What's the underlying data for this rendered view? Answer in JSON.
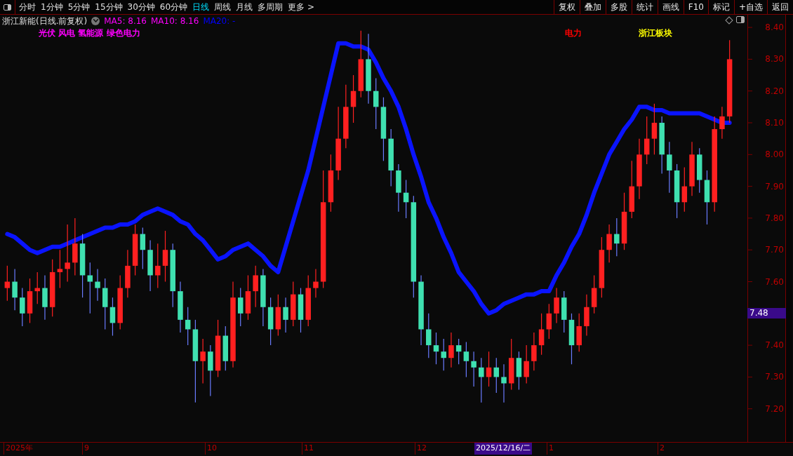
{
  "toolbar": {
    "periods": [
      {
        "label": "分时",
        "selected": false
      },
      {
        "label": "1分钟",
        "selected": false
      },
      {
        "label": "5分钟",
        "selected": false
      },
      {
        "label": "15分钟",
        "selected": false
      },
      {
        "label": "30分钟",
        "selected": false
      },
      {
        "label": "60分钟",
        "selected": false
      },
      {
        "label": "日线",
        "selected": true
      },
      {
        "label": "周线",
        "selected": false
      },
      {
        "label": "月线",
        "selected": false
      },
      {
        "label": "多周期",
        "selected": false
      }
    ],
    "more": "更多 >",
    "actions": [
      "复权",
      "叠加",
      "多股",
      "统计",
      "画线",
      "F10",
      "标记",
      "+自选",
      "返回"
    ]
  },
  "header": {
    "title": "浙江新能(日线.前复权)",
    "indicators": [
      {
        "label": "MA5: 8.16",
        "color": "#ff00ff"
      },
      {
        "label": "MA10: 8.16",
        "color": "#ff00ff"
      },
      {
        "label": "MA20: -",
        "color": "#0000ff"
      }
    ]
  },
  "tags": [
    {
      "text": "光伏 风电 氢能源 绿色电力",
      "color": "#ff00ff"
    },
    {
      "text": "电力",
      "color": "#ff0000"
    },
    {
      "text": "浙江板块",
      "color": "#ffff00"
    }
  ],
  "chart_data": {
    "type": "candlestick",
    "ylim": [
      7.1,
      8.44
    ],
    "series": [
      {
        "type": "line",
        "color": "#0a14ff",
        "values": [
          7.75,
          7.74,
          7.72,
          7.7,
          7.69,
          7.7,
          7.71,
          7.71,
          7.72,
          7.73,
          7.74,
          7.75,
          7.76,
          7.77,
          7.77,
          7.78,
          7.78,
          7.79,
          7.81,
          7.82,
          7.83,
          7.82,
          7.81,
          7.79,
          7.78,
          7.75,
          7.73,
          7.7,
          7.67,
          7.68,
          7.7,
          7.71,
          7.72,
          7.7,
          7.68,
          7.65,
          7.63,
          7.71,
          7.79,
          7.87,
          7.95,
          8.05,
          8.15,
          8.25,
          8.35,
          8.35,
          8.34,
          8.34,
          8.33,
          8.29,
          8.24,
          8.2,
          8.15,
          8.08,
          8.0,
          7.93,
          7.85,
          7.8,
          7.74,
          7.69,
          7.63,
          7.6,
          7.57,
          7.53,
          7.5,
          7.51,
          7.53,
          7.54,
          7.55,
          7.56,
          7.56,
          7.57,
          7.57,
          7.62,
          7.66,
          7.71,
          7.75,
          7.81,
          7.88,
          7.94,
          8.0,
          8.04,
          8.08,
          8.11,
          8.15,
          8.15,
          8.14,
          8.14,
          8.13,
          8.13,
          8.13,
          8.13,
          8.13,
          8.12,
          8.11,
          8.1,
          8.1
        ]
      }
    ],
    "ohlc": [
      [
        7.58,
        7.65,
        7.54,
        7.6
      ],
      [
        7.6,
        7.64,
        7.51,
        7.55
      ],
      [
        7.55,
        7.58,
        7.46,
        7.5
      ],
      [
        7.5,
        7.61,
        7.47,
        7.57
      ],
      [
        7.57,
        7.63,
        7.53,
        7.58
      ],
      [
        7.58,
        7.62,
        7.48,
        7.52
      ],
      [
        7.52,
        7.67,
        7.49,
        7.63
      ],
      [
        7.63,
        7.7,
        7.58,
        7.64
      ],
      [
        7.64,
        7.78,
        7.6,
        7.66
      ],
      [
        7.66,
        7.8,
        7.62,
        7.72
      ],
      [
        7.72,
        7.75,
        7.55,
        7.62
      ],
      [
        7.62,
        7.66,
        7.5,
        7.6
      ],
      [
        7.6,
        7.64,
        7.54,
        7.58
      ],
      [
        7.58,
        7.61,
        7.45,
        7.52
      ],
      [
        7.52,
        7.55,
        7.43,
        7.47
      ],
      [
        7.47,
        7.62,
        7.45,
        7.58
      ],
      [
        7.58,
        7.7,
        7.55,
        7.65
      ],
      [
        7.65,
        7.78,
        7.62,
        7.75
      ],
      [
        7.75,
        7.77,
        7.64,
        7.7
      ],
      [
        7.7,
        7.73,
        7.57,
        7.62
      ],
      [
        7.62,
        7.72,
        7.58,
        7.65
      ],
      [
        7.65,
        7.76,
        7.6,
        7.7
      ],
      [
        7.7,
        7.72,
        7.52,
        7.57
      ],
      [
        7.57,
        7.6,
        7.44,
        7.48
      ],
      [
        7.48,
        7.52,
        7.4,
        7.45
      ],
      [
        7.45,
        7.48,
        7.22,
        7.35
      ],
      [
        7.35,
        7.42,
        7.28,
        7.38
      ],
      [
        7.38,
        7.4,
        7.24,
        7.32
      ],
      [
        7.32,
        7.48,
        7.3,
        7.43
      ],
      [
        7.43,
        7.46,
        7.32,
        7.35
      ],
      [
        7.35,
        7.6,
        7.33,
        7.55
      ],
      [
        7.55,
        7.58,
        7.46,
        7.5
      ],
      [
        7.5,
        7.62,
        7.48,
        7.57
      ],
      [
        7.57,
        7.65,
        7.52,
        7.62
      ],
      [
        7.62,
        7.64,
        7.46,
        7.52
      ],
      [
        7.52,
        7.55,
        7.4,
        7.45
      ],
      [
        7.45,
        7.56,
        7.43,
        7.52
      ],
      [
        7.52,
        7.55,
        7.44,
        7.48
      ],
      [
        7.48,
        7.6,
        7.46,
        7.56
      ],
      [
        7.56,
        7.58,
        7.44,
        7.48
      ],
      [
        7.48,
        7.62,
        7.46,
        7.58
      ],
      [
        7.58,
        7.64,
        7.55,
        7.6
      ],
      [
        7.6,
        7.95,
        7.58,
        7.85
      ],
      [
        7.85,
        8.0,
        7.82,
        7.95
      ],
      [
        7.95,
        8.15,
        7.92,
        8.05
      ],
      [
        8.05,
        8.22,
        8.02,
        8.15
      ],
      [
        8.15,
        8.25,
        8.1,
        8.2
      ],
      [
        8.2,
        8.39,
        8.18,
        8.3
      ],
      [
        8.3,
        8.38,
        8.16,
        8.2
      ],
      [
        8.2,
        8.24,
        8.08,
        8.15
      ],
      [
        8.15,
        8.18,
        7.98,
        8.05
      ],
      [
        8.05,
        8.08,
        7.9,
        7.95
      ],
      [
        7.95,
        7.97,
        7.82,
        7.88
      ],
      [
        7.88,
        7.92,
        7.8,
        7.85
      ],
      [
        7.85,
        7.87,
        7.55,
        7.6
      ],
      [
        7.6,
        7.62,
        7.4,
        7.45
      ],
      [
        7.45,
        7.5,
        7.36,
        7.4
      ],
      [
        7.4,
        7.44,
        7.34,
        7.38
      ],
      [
        7.38,
        7.42,
        7.32,
        7.36
      ],
      [
        7.36,
        7.44,
        7.33,
        7.4
      ],
      [
        7.4,
        7.42,
        7.34,
        7.38
      ],
      [
        7.38,
        7.41,
        7.3,
        7.35
      ],
      [
        7.35,
        7.38,
        7.27,
        7.33
      ],
      [
        7.33,
        7.36,
        7.22,
        7.3
      ],
      [
        7.3,
        7.38,
        7.27,
        7.33
      ],
      [
        7.33,
        7.36,
        7.25,
        7.3
      ],
      [
        7.3,
        7.34,
        7.22,
        7.28
      ],
      [
        7.28,
        7.42,
        7.26,
        7.36
      ],
      [
        7.36,
        7.38,
        7.26,
        7.3
      ],
      [
        7.3,
        7.4,
        7.28,
        7.35
      ],
      [
        7.35,
        7.44,
        7.32,
        7.4
      ],
      [
        7.4,
        7.5,
        7.37,
        7.45
      ],
      [
        7.45,
        7.53,
        7.42,
        7.5
      ],
      [
        7.5,
        7.58,
        7.47,
        7.55
      ],
      [
        7.55,
        7.57,
        7.44,
        7.48
      ],
      [
        7.48,
        7.5,
        7.34,
        7.4
      ],
      [
        7.4,
        7.5,
        7.38,
        7.46
      ],
      [
        7.46,
        7.56,
        7.43,
        7.52
      ],
      [
        7.52,
        7.62,
        7.5,
        7.58
      ],
      [
        7.58,
        7.74,
        7.55,
        7.7
      ],
      [
        7.7,
        7.78,
        7.66,
        7.75
      ],
      [
        7.75,
        7.8,
        7.68,
        7.72
      ],
      [
        7.72,
        7.88,
        7.7,
        7.82
      ],
      [
        7.82,
        7.98,
        7.8,
        7.9
      ],
      [
        7.9,
        8.05,
        7.86,
        8.0
      ],
      [
        8.0,
        8.12,
        7.97,
        8.05
      ],
      [
        8.05,
        8.16,
        8.0,
        8.1
      ],
      [
        8.1,
        8.12,
        7.94,
        8.0
      ],
      [
        8.0,
        8.04,
        7.88,
        7.95
      ],
      [
        7.95,
        7.97,
        7.8,
        7.85
      ],
      [
        7.85,
        7.96,
        7.82,
        7.9
      ],
      [
        7.9,
        8.04,
        7.87,
        8.0
      ],
      [
        8.0,
        8.02,
        7.88,
        7.92
      ],
      [
        7.92,
        7.95,
        7.78,
        7.85
      ],
      [
        7.85,
        8.12,
        7.82,
        8.08
      ],
      [
        8.08,
        8.15,
        8.05,
        8.12
      ],
      [
        8.12,
        8.36,
        8.1,
        8.3
      ]
    ],
    "yticks": [
      {
        "value": 8.4,
        "label": "8.40"
      },
      {
        "value": 8.3,
        "label": "8.30"
      },
      {
        "value": 8.2,
        "label": "8.20"
      },
      {
        "value": 8.1,
        "label": "8.10"
      },
      {
        "value": 8.0,
        "label": "8.00"
      },
      {
        "value": 7.9,
        "label": "7.90"
      },
      {
        "value": 7.8,
        "label": "7.80"
      },
      {
        "value": 7.7,
        "label": "7.70"
      },
      {
        "value": 7.6,
        "label": "7.60"
      },
      {
        "value": 7.4,
        "label": "7.40"
      },
      {
        "value": 7.3,
        "label": "7.30"
      },
      {
        "value": 7.2,
        "label": "7.20"
      }
    ]
  },
  "current_price": "7.48",
  "time_axis": [
    {
      "label": "2025年",
      "selected": false
    },
    {
      "label": "9",
      "selected": false
    },
    {
      "label": "10",
      "selected": false
    },
    {
      "label": "11",
      "selected": false
    },
    {
      "label": "12",
      "selected": false
    },
    {
      "label": "2025/12/16/二",
      "selected": true
    },
    {
      "label": "1",
      "selected": false
    },
    {
      "label": "2",
      "selected": false
    }
  ]
}
